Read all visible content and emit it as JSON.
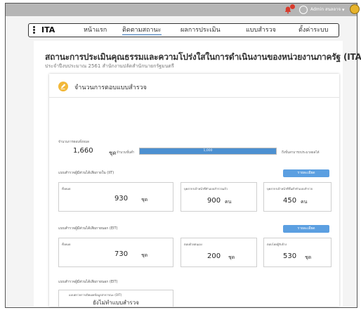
{
  "topbar": {
    "user_name": "Admin สนลอาจ",
    "icons": [
      "bell-icon",
      "user-circle-icon",
      "chevron-down-icon",
      "avatar-icon"
    ],
    "notification_color": "#d83a2b",
    "avatar_color": "#e7b32b"
  },
  "nav": {
    "brand": "ITA",
    "items": [
      {
        "label": "หน้าแรก",
        "active": false
      },
      {
        "label": "ติดตามสถานะ",
        "active": true
      },
      {
        "label": "ผลการประเมิน",
        "active": false
      },
      {
        "label": "แบบสำรวจ",
        "active": false
      },
      {
        "label": "ตั้งค่าระบบ",
        "active": false
      }
    ],
    "accent_color": "#2f6db5"
  },
  "page": {
    "title": "สถานะการประเมินคุณธรรมและความโปร่งใสในการดำเนินงานของหน่วยงานภาครัฐ (ITA)",
    "subtitle": "ประจำปีงบประมาณ 2561 สำนักงานปลัดสำนักนายกรัฐมนตรี"
  },
  "card": {
    "title": "จำนวนการตอบแบบสำรวจ",
    "total_label": "จำนวนการตอบทั้งหมด",
    "total_value": "1,660",
    "total_unit": "ชุด",
    "min_label": "จำนวนขั้นต่ำ",
    "progress_text": "1,000",
    "progress_fraction": 1.0,
    "progress_note": "ถึงขั้นสามารถประมวลผลได้",
    "progress_color": "#4c90d1",
    "iit": {
      "label": "แบบสำรวจผู้มีส่วนได้เสียภายใน (IIT)",
      "button": "รายละเอียด",
      "total_label": "ทั้งหมด",
      "total_value": "930",
      "total_unit": "ชุด",
      "staff_label": "บุคลากรเจ้าหน้าที่ทำแบบสำรวจแล้ว",
      "staff_value": "900",
      "staff_unit": "คน",
      "min_label": "บุคลากรเจ้าหน้าที่ขั้นต่ำทำแบบสำรวจ",
      "min_value": "450",
      "min_unit": "คน"
    },
    "eit": {
      "label": "แบบสำรวจผู้มีส่วนได้เสียภายนอก (EIT)",
      "button": "รายละเอียด",
      "total_label": "ทั้งหมด",
      "total_value": "730",
      "total_unit": "ชุด",
      "self_label": "ตอบด้วยตนเอง",
      "self_value": "200",
      "self_unit": "ชุด",
      "staff_label": "ตอบโดยผู้รับจ้าง",
      "staff_value": "530",
      "staff_unit": "ชุด"
    },
    "oit": {
      "label": "แบบสำรวจผู้มีส่วนได้เสียภายนอก (EIT)",
      "box_label": "แบบตรวจการเปิดเผยข้อมูลสาธารณะ (OIT)",
      "status": "ยังไม่ทำแบบสำรวจ"
    },
    "button_color": "#5b9fe1"
  }
}
